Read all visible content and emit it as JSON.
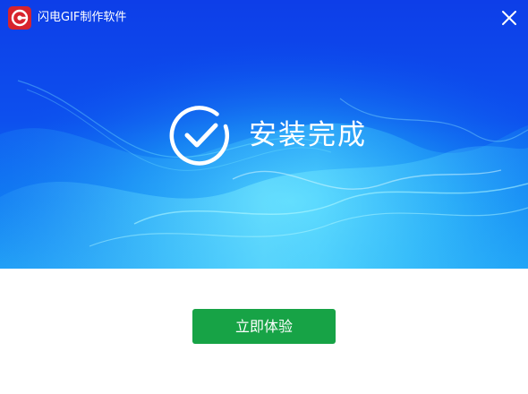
{
  "window": {
    "title": "闪电GIF制作软件",
    "logo_icon": "app-logo-icon",
    "close_icon": "close-icon"
  },
  "hero": {
    "status_icon": "check-circle-icon",
    "status_text": "安装完成"
  },
  "actions": {
    "primary_label": "立即体验"
  },
  "colors": {
    "hero_top": "#0d3ee8",
    "hero_bottom": "#1a9df5",
    "wave": "#3fd6ff",
    "button": "#17a346",
    "logo": "#d7232d"
  }
}
